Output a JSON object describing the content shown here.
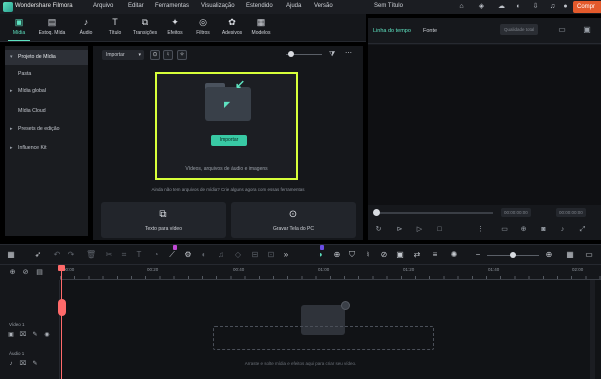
{
  "title_bar": {
    "app_title": "Wondershare Filmora",
    "menu": [
      "Arquivo",
      "Editar",
      "Ferramentas",
      "Visualização",
      "Estendido",
      "Ajuda",
      "Versão"
    ],
    "project_title": "Sem Título",
    "buy_label": "Compr"
  },
  "toolbar": {
    "items": [
      {
        "label": "Mídia",
        "icon": "media-icon"
      },
      {
        "label": "Estoq. Mída",
        "icon": "stock-media-icon"
      },
      {
        "label": "Áudio",
        "icon": "audio-icon"
      },
      {
        "label": "Título",
        "icon": "title-icon"
      },
      {
        "label": "Transições",
        "icon": "transitions-icon"
      },
      {
        "label": "Efeitos",
        "icon": "effects-icon"
      },
      {
        "label": "Filtros",
        "icon": "filters-icon"
      },
      {
        "label": "Adesivos",
        "icon": "stickers-icon"
      },
      {
        "label": "Modelos",
        "icon": "templates-icon"
      }
    ]
  },
  "left_nav": {
    "items": [
      {
        "label": "Projeto de Mídia",
        "caret": "▾",
        "selected": true
      },
      {
        "label": "Pasta",
        "caret": ""
      },
      {
        "label": "Mídia global",
        "caret": "▸"
      },
      {
        "label": "Mídia Cloud",
        "caret": ""
      },
      {
        "label": "Presets de edição",
        "caret": "▸"
      },
      {
        "label": "Influence Kit",
        "caret": "▸"
      }
    ]
  },
  "media": {
    "import_dropdown": "Importar",
    "import_button": "Importar",
    "drop_hint": "Vídeos, arquivos de áudio e imagens",
    "sub_hint": "Ainda não tem arquivos de mídia? Crie alguns agora com essas ferramentas",
    "cards": [
      {
        "label": "Texto para vídeo",
        "icon": "text-to-video-icon"
      },
      {
        "label": "Gravar Tela do PC",
        "icon": "record-screen-icon"
      }
    ]
  },
  "player": {
    "tabs": [
      "Linha do tempo",
      "Fonte"
    ],
    "quality_label": "Qualidade total",
    "time_current": "00:00:00:00",
    "time_total": "00:00:00:00"
  },
  "timeline": {
    "ruler_labels": [
      "00:00",
      "00:20",
      "00:40",
      "01:00",
      "01:20",
      "01:40",
      "02:00",
      "02:20"
    ],
    "tracks": [
      {
        "name": "Vídeo 1"
      },
      {
        "name": "Áudio 1"
      }
    ],
    "drop_hint": "Arraste e solte mídia e efeitos aqui para criar seu vídeo."
  },
  "colors": {
    "accent": "#5ee3c1",
    "highlight_border": "#d7ff3a",
    "buy": "#e35a2c",
    "playhead": "#ff6a6a"
  }
}
